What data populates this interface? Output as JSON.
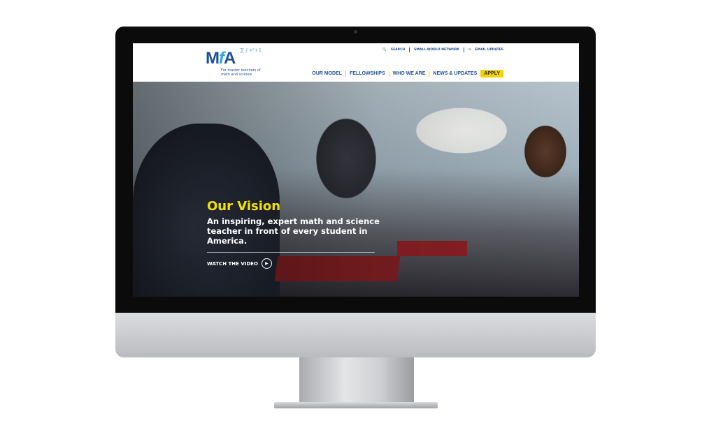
{
  "site": {
    "logo": {
      "mark_m": "M",
      "mark_f": "f",
      "mark_a": "A",
      "tagline": "For master teachers of math and science",
      "math": "∑ ∫ x²+1"
    },
    "utility": [
      {
        "icon": "search-icon",
        "label": "SEARCH"
      },
      {
        "label": "SMALL-WORLD NETWORK"
      },
      {
        "icon": "email-icon",
        "label": "EMAIL UPDATES"
      }
    ],
    "nav": [
      "OUR MODEL",
      "FELLOWSHIPS",
      "WHO WE ARE",
      "NEWS & UPDATES"
    ],
    "apply_label": "APPLY",
    "hero": {
      "title": "Our Vision",
      "text": "An inspiring, expert math and science teacher in front of every student in America.",
      "cta": "WATCH THE VIDEO"
    },
    "colors": {
      "brand_blue": "#1f4e9b",
      "accent_yellow": "#f5d100"
    }
  }
}
